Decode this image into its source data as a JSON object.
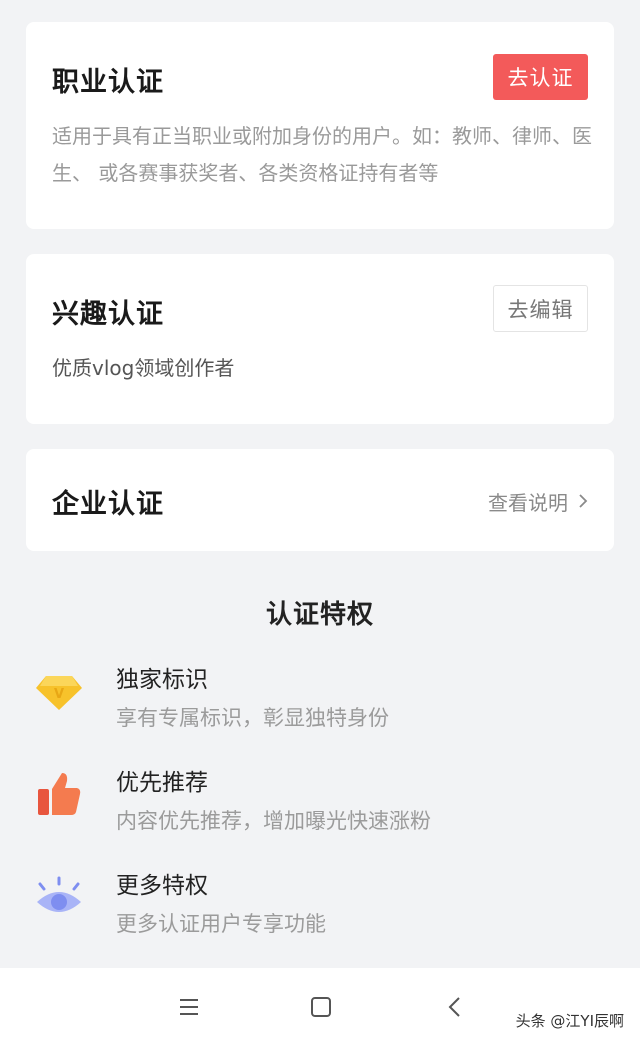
{
  "professional_cert": {
    "title": "职业认证",
    "button": "去认证",
    "description": "适用于具有正当职业或附加身份的用户。如：教师、律师、医生、 或各赛事获奖者、各类资格证持有者等"
  },
  "interest_cert": {
    "title": "兴趣认证",
    "button": "去编辑",
    "description": "优质vlog领域创作者"
  },
  "enterprise_cert": {
    "title": "企业认证",
    "link": "查看说明"
  },
  "privileges": {
    "title": "认证特权",
    "items": [
      {
        "title": "独家标识",
        "desc": "享有专属标识，彰显独特身份",
        "icon": "diamond-icon"
      },
      {
        "title": "优先推荐",
        "desc": "内容优先推荐，增加曝光快速涨粉",
        "icon": "thumbs-up-icon"
      },
      {
        "title": "更多特权",
        "desc": "更多认证用户专享功能",
        "icon": "eye-icon"
      }
    ]
  },
  "navbar": {
    "watermark": "头条 @江YI辰啊"
  },
  "colors": {
    "accent_red": "#f35a5a",
    "background": "#f2f3f5"
  }
}
